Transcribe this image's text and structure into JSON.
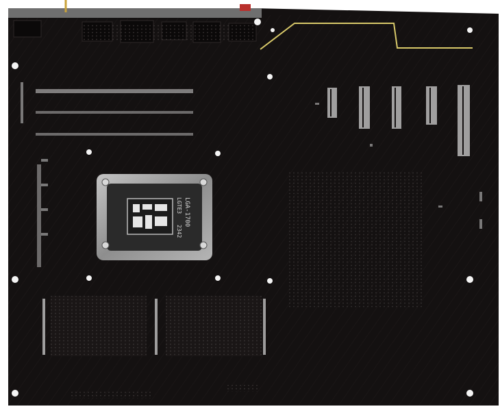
{
  "photo": {
    "subject": "motherboard-back-side",
    "colors": {
      "background": "#ffffff",
      "pcb": "#141111",
      "pcb_dark": "#0c0a0a",
      "trace": "#2a2424",
      "hole": "#f4f4f4",
      "gold_trace": "#d8c96a",
      "backplate": "#9a9a9a",
      "backplate_dark": "#2a2a2a"
    }
  },
  "backplate": {
    "label_line1": "LGA-1700",
    "label_line2": "LGTE3",
    "label_line3": "2342"
  }
}
